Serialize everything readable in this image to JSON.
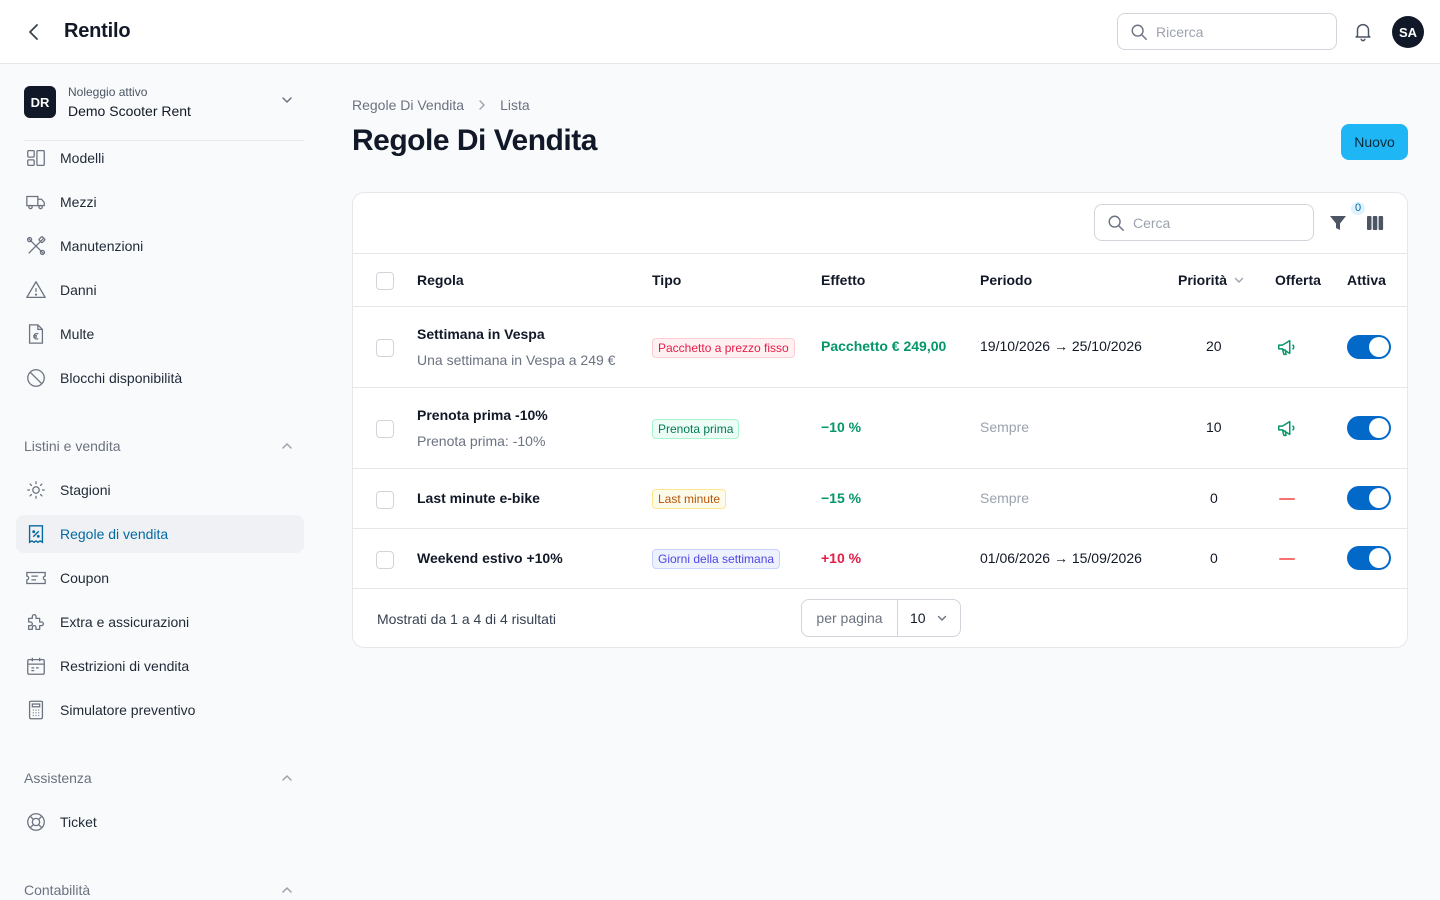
{
  "header": {
    "title": "Rentilo",
    "search_placeholder": "Ricerca",
    "avatar_initials": "SA"
  },
  "tenant": {
    "badge": "DR",
    "subtitle": "Noleggio attivo",
    "name": "Demo Scooter Rent"
  },
  "sidebar": {
    "items": [
      {
        "label": "Modelli",
        "icon": "models-icon"
      },
      {
        "label": "Mezzi",
        "icon": "truck-icon"
      },
      {
        "label": "Manutenzioni",
        "icon": "tools-icon"
      },
      {
        "label": "Danni",
        "icon": "warning-icon"
      },
      {
        "label": "Multe",
        "icon": "euro-document-icon"
      },
      {
        "label": "Blocchi disponibilità",
        "icon": "ban-icon"
      }
    ],
    "groups": {
      "sales": {
        "label": "Listini e vendita",
        "items": [
          {
            "label": "Stagioni",
            "icon": "sun-icon"
          },
          {
            "label": "Regole di vendita",
            "icon": "receipt-percent-icon",
            "active": true
          },
          {
            "label": "Coupon",
            "icon": "ticket-icon"
          },
          {
            "label": "Extra e assicurazioni",
            "icon": "puzzle-icon"
          },
          {
            "label": "Restrizioni di vendita",
            "icon": "calendar-icon"
          },
          {
            "label": "Simulatore preventivo",
            "icon": "calculator-icon"
          }
        ]
      },
      "support": {
        "label": "Assistenza",
        "items": [
          {
            "label": "Ticket",
            "icon": "lifebuoy-icon"
          }
        ]
      },
      "accounting": {
        "label": "Contabilità"
      }
    }
  },
  "breadcrumb": {
    "parent": "Regole Di Vendita",
    "current": "Lista"
  },
  "page": {
    "title": "Regole Di Vendita",
    "new_button": "Nuovo"
  },
  "table": {
    "search_placeholder": "Cerca",
    "filter_count": "0",
    "columns": {
      "rule": "Regola",
      "type": "Tipo",
      "effect": "Effetto",
      "period": "Periodo",
      "priority": "Priorità",
      "offer": "Offerta",
      "active": "Attiva"
    },
    "rows": [
      {
        "name": "Settimana in Vespa",
        "description": "Una settimana in Vespa a 249 €",
        "type": "Pacchetto a prezzo fisso",
        "type_color": "#e11d48",
        "effect": "Pacchetto € 249,00",
        "effect_color": "#059669",
        "period": "19/10/2026 → 25/10/2026",
        "priority": "20",
        "offer": true,
        "active": true
      },
      {
        "name": "Prenota prima -10%",
        "description": "Prenota prima: -10%",
        "type": "Prenota prima",
        "type_color": "#047857",
        "effect": "−10 %",
        "effect_color": "#059669",
        "period": "Sempre",
        "priority": "10",
        "offer": true,
        "active": true
      },
      {
        "name": "Last minute e-bike",
        "description": "",
        "type": "Last minute",
        "type_color": "#b45309",
        "effect": "−15 %",
        "effect_color": "#059669",
        "period": "Sempre",
        "priority": "0",
        "offer": false,
        "active": true
      },
      {
        "name": "Weekend estivo +10%",
        "description": "",
        "type": "Giorni della settimana",
        "type_color": "#4f46e5",
        "effect": "+10 %",
        "effect_color": "#e11d48",
        "period": "01/06/2026 → 15/09/2026",
        "priority": "0",
        "offer": false,
        "active": true
      }
    ],
    "footer": {
      "summary": "Mostrati da 1 a 4 di 4 risultati",
      "per_page_label": "per pagina",
      "per_page_value": "10"
    }
  }
}
